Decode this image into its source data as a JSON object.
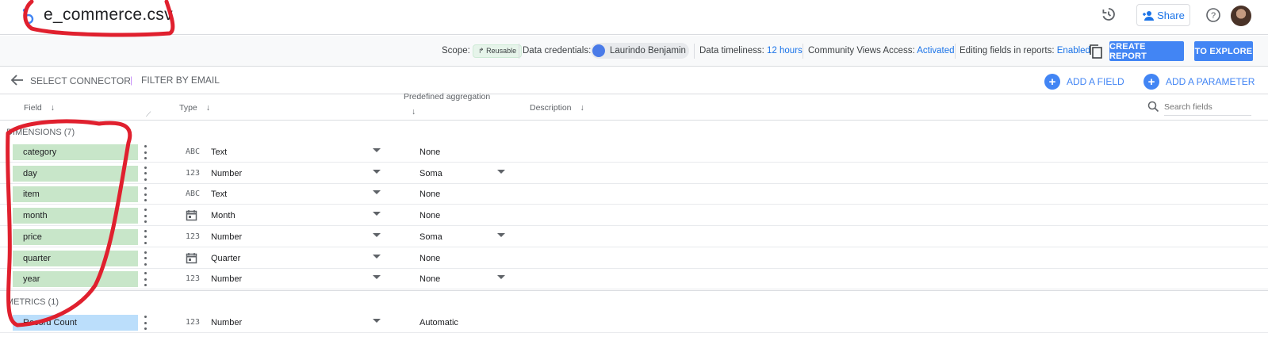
{
  "topbar": {
    "title": "e_commerce.csv",
    "share_label": "Share"
  },
  "infobar": {
    "scope_label": "Scope:",
    "scope_badge": "Reusable",
    "credentials_label": "Data credentials:",
    "credentials_user": "Laurindo Benjamin",
    "timeliness_label": "Data timeliness:",
    "timeliness_value": "12 hours",
    "community_label": "Community Views Access:",
    "community_value": "Activated",
    "editing_label": "Editing fields in reports:",
    "editing_value": "Enabled",
    "create_report": "CREATE REPORT",
    "to_explore": "TO EXPLORE"
  },
  "toolbar": {
    "select_connector": "SELECT CONNECTOR",
    "filter_by_email": "FILTER BY EMAIL",
    "add_field": "ADD A FIELD",
    "add_parameter": "ADD A PARAMETER"
  },
  "columns": {
    "field": "Field",
    "type": "Type",
    "aggregation": "Predefined aggregation",
    "description": "Description",
    "search_placeholder": "Search fields"
  },
  "sections": {
    "dimensions": "DIMENSIONS (7)",
    "metrics": "METRICS (1)"
  },
  "dimensions": [
    {
      "name": "category",
      "type_icon": "ABC",
      "type": "Text",
      "aggregation": "None",
      "agg_dropdown": false
    },
    {
      "name": "day",
      "type_icon": "123",
      "type": "Number",
      "aggregation": "Soma",
      "agg_dropdown": true
    },
    {
      "name": "item",
      "type_icon": "ABC",
      "type": "Text",
      "aggregation": "None",
      "agg_dropdown": false
    },
    {
      "name": "month",
      "type_icon": "calendar-icon",
      "type": "Month",
      "aggregation": "None",
      "agg_dropdown": false
    },
    {
      "name": "price",
      "type_icon": "123",
      "type": "Number",
      "aggregation": "Soma",
      "agg_dropdown": true
    },
    {
      "name": "quarter",
      "type_icon": "calendar-icon",
      "type": "Quarter",
      "aggregation": "None",
      "agg_dropdown": false
    },
    {
      "name": "year",
      "type_icon": "123",
      "type": "Number",
      "aggregation": "None",
      "agg_dropdown": true
    }
  ],
  "metrics": [
    {
      "name": "Record Count",
      "type_icon": "123",
      "type": "Number",
      "aggregation": "Automatic",
      "agg_dropdown": false
    }
  ],
  "colors": {
    "accent": "#4285f4",
    "link": "#1a73e8",
    "dimension_chip": "#c8e6c9",
    "metric_chip": "#bbdefb",
    "annotation": "#e0202e"
  }
}
